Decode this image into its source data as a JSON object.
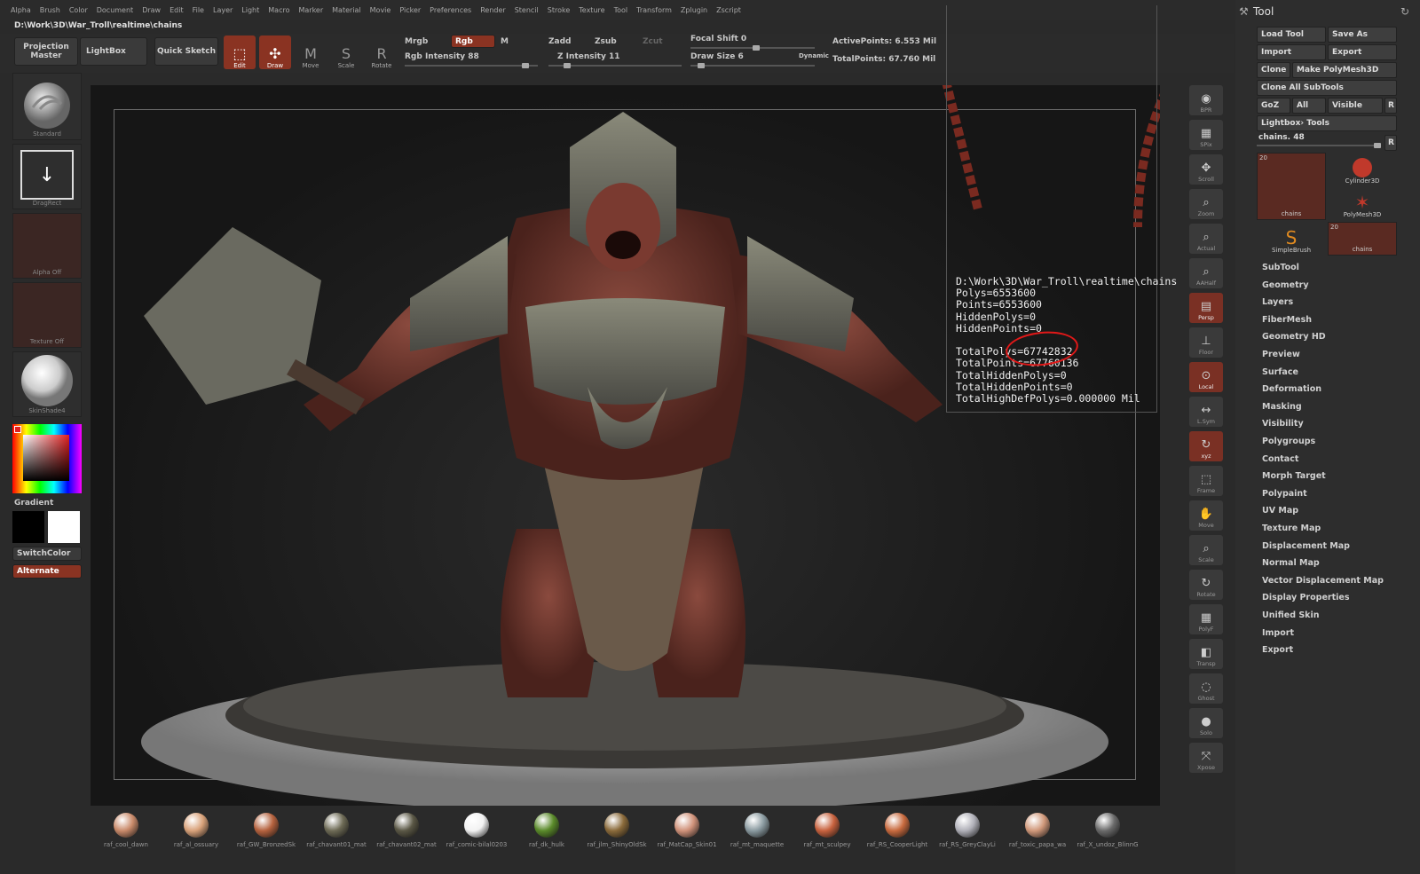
{
  "menu": [
    "Alpha",
    "Brush",
    "Color",
    "Document",
    "Draw",
    "Edit",
    "File",
    "Layer",
    "Light",
    "Macro",
    "Marker",
    "Material",
    "Movie",
    "Picker",
    "Preferences",
    "Render",
    "Stencil",
    "Stroke",
    "Texture",
    "Tool",
    "Transform",
    "Zplugin",
    "Zscript"
  ],
  "path": "D:\\Work\\3D\\War_Troll\\realtime\\chains",
  "toolbar": {
    "projection_master": "Projection Master",
    "lightbox": "LightBox",
    "quick_sketch": "Quick Sketch",
    "edit": "Edit",
    "draw": "Draw",
    "move": "Move",
    "scale": "Scale",
    "rotate": "Rotate",
    "mrgb": "Mrgb",
    "rgb": "Rgb",
    "m": "M",
    "zadd": "Zadd",
    "zsub": "Zsub",
    "zcut": "Zcut",
    "rgb_intensity": "Rgb Intensity 88",
    "rgb_intensity_value": 88,
    "z_intensity": "Z Intensity 11",
    "z_intensity_value": 11,
    "focal_shift": "Focal Shift 0",
    "focal_shift_value": 0,
    "draw_size": "Draw Size 6",
    "draw_size_value": 6,
    "dynamic": "Dynamic",
    "active_points": "ActivePoints: 6.553 Mil",
    "total_points": "TotalPoints: 67.760 Mil"
  },
  "left_shelf": {
    "brush": "Standard",
    "stroke": "DragRect",
    "alpha": "Alpha Off",
    "texture": "Texture Off",
    "material": "SkinShade4",
    "gradient": "Gradient",
    "switch_color": "SwitchColor",
    "alternate": "Alternate"
  },
  "info": {
    "lines": [
      "D:\\Work\\3D\\War_Troll\\realtime\\chains",
      "Polys=6553600",
      "Points=6553600",
      "HiddenPolys=0",
      "HiddenPoints=0",
      "",
      "TotalPolys=67742832",
      "TotalPoints=67760136",
      "TotalHiddenPolys=0",
      "TotalHiddenPoints=0",
      "TotalHighDefPolys=0.000000 Mil"
    ]
  },
  "right_shelf": [
    "BPR",
    "SPix",
    "Scroll",
    "Zoom",
    "Actual",
    "AAHalf",
    "Persp",
    "Floor",
    "Local",
    "L.Sym",
    "xyz",
    "Frame",
    "Move",
    "Scale",
    "Rotate",
    "PolyF",
    "Transp",
    "Ghost",
    "Solo",
    "Xpose"
  ],
  "tool_panel": {
    "title": "Tool",
    "load_tool": "Load Tool",
    "save_as": "Save As",
    "import": "Import",
    "export": "Export",
    "clone": "Clone",
    "make_polymesh": "Make PolyMesh3D",
    "clone_all": "Clone All SubTools",
    "goz": "GoZ",
    "all": "All",
    "visible": "Visible",
    "r": "R",
    "lightbox_tools": "Lightbox› Tools",
    "chains_slider": "chains. 48",
    "chains_slider_value": 48,
    "thumbs": [
      {
        "label": "chains",
        "count": "20"
      },
      {
        "label": "Cylinder3D",
        "count": ""
      },
      {
        "label": "PolyMesh3D",
        "count": ""
      },
      {
        "label": "SimpleBrush",
        "count": ""
      },
      {
        "label": "chains",
        "count": "20"
      }
    ],
    "menu": [
      "SubTool",
      "Geometry",
      "Layers",
      "FiberMesh",
      "Geometry HD",
      "Preview",
      "Surface",
      "Deformation",
      "Masking",
      "Visibility",
      "Polygroups",
      "Contact",
      "Morph Target",
      "Polypaint",
      "UV Map",
      "Texture Map",
      "Displacement Map",
      "Normal Map",
      "Vector Displacement Map",
      "Display Properties",
      "Unified Skin",
      "Import",
      "Export"
    ]
  },
  "materials": [
    {
      "name": "raf_cool_dawn",
      "color": "#c98a6a"
    },
    {
      "name": "raf_al_ossuary",
      "color": "#d9a27a"
    },
    {
      "name": "raf_GW_BronzedSk",
      "color": "#b5623e"
    },
    {
      "name": "raf_chavant01_mat",
      "color": "#6d6a55"
    },
    {
      "name": "raf_chavant02_mat",
      "color": "#5a5745"
    },
    {
      "name": "raf_comic-bilal0203",
      "color": "#f2f2f2"
    },
    {
      "name": "raf_dk_hulk",
      "color": "#5a8a2a"
    },
    {
      "name": "raf_jlm_ShinyOldSk",
      "color": "#8a6a3a"
    },
    {
      "name": "raf_MatCap_Skin01",
      "color": "#d0927a"
    },
    {
      "name": "raf_mt_maquette",
      "color": "#8a9aa0"
    },
    {
      "name": "raf_mt_sculpey",
      "color": "#c8623e"
    },
    {
      "name": "raf_RS_CooperLight",
      "color": "#c86a3e"
    },
    {
      "name": "raf_RS_GreyClayLi",
      "color": "#b0b0b8"
    },
    {
      "name": "raf_toxic_papa_wa",
      "color": "#d0987a"
    },
    {
      "name": "raf_X_undoz_BlinnG",
      "color": "#6a6a6a"
    }
  ]
}
